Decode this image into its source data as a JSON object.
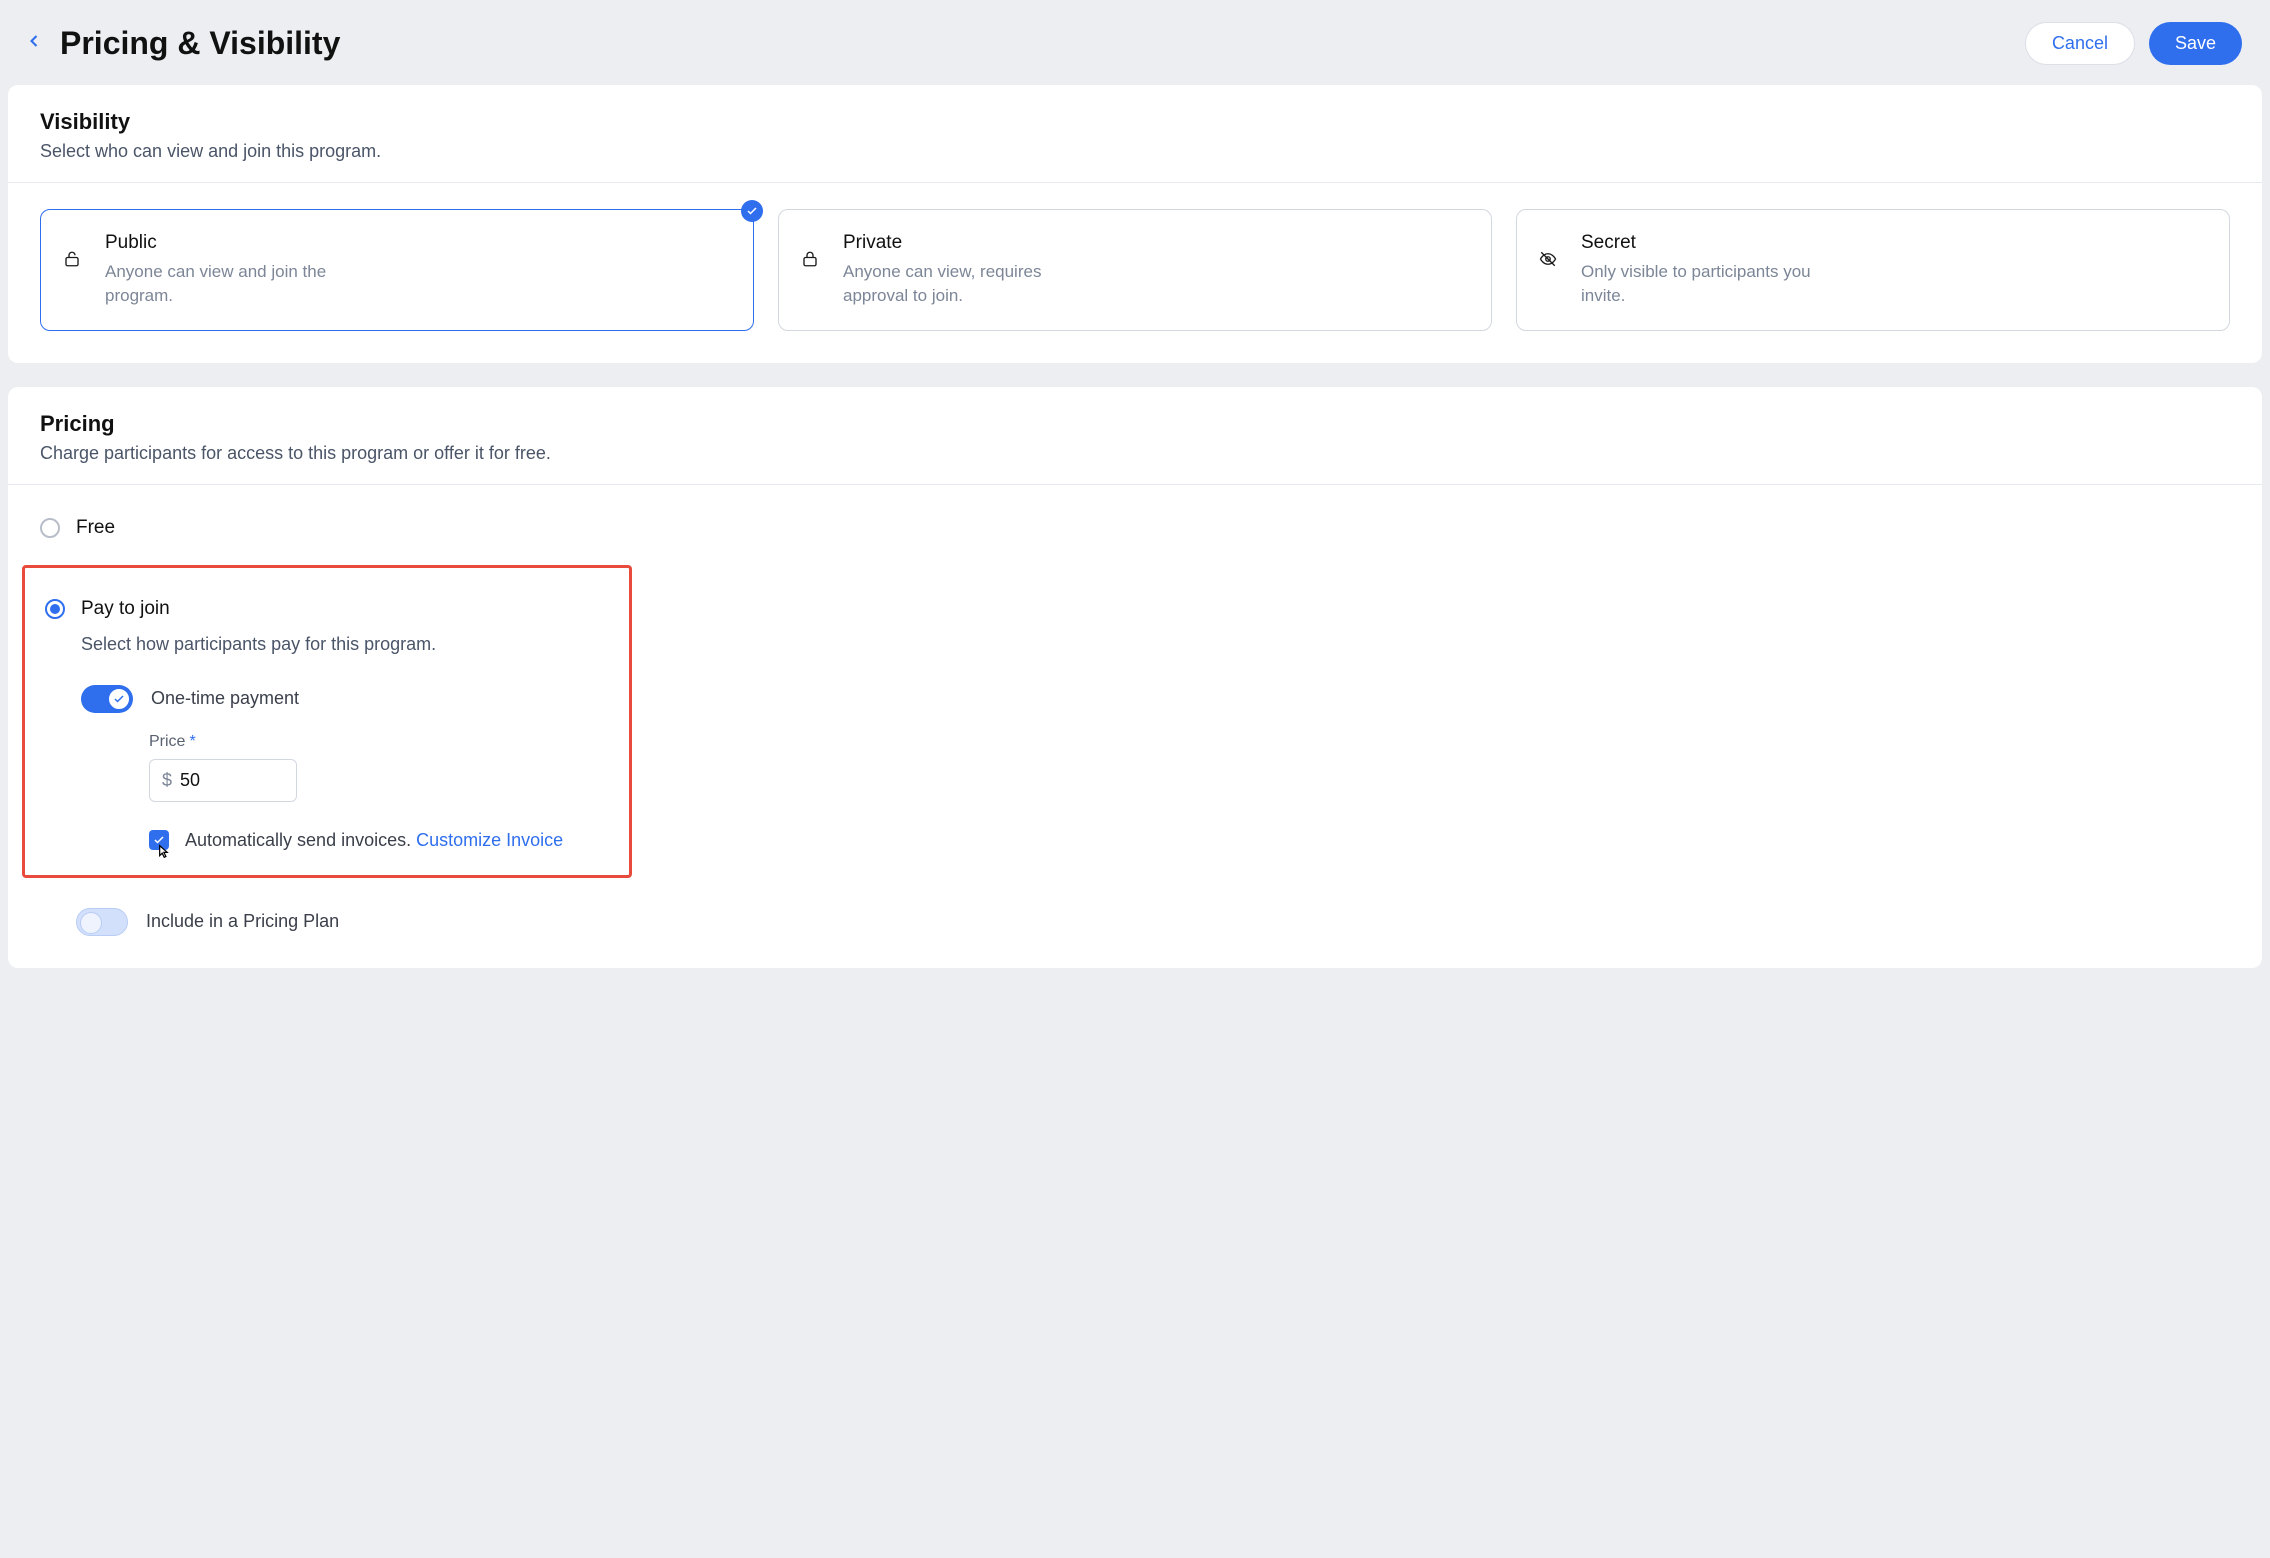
{
  "header": {
    "title": "Pricing & Visibility",
    "cancel": "Cancel",
    "save": "Save"
  },
  "visibility": {
    "title": "Visibility",
    "subtitle": "Select who can view and join this program.",
    "options": [
      {
        "title": "Public",
        "desc": "Anyone can view and join the program.",
        "selected": true
      },
      {
        "title": "Private",
        "desc": "Anyone can view, requires approval to join.",
        "selected": false
      },
      {
        "title": "Secret",
        "desc": "Only visible to participants you invite.",
        "selected": false
      }
    ]
  },
  "pricing": {
    "title": "Pricing",
    "subtitle": "Charge participants for access to this program or offer it for free.",
    "free_label": "Free",
    "pay_label": "Pay to join",
    "pay_desc": "Select how participants pay for this program.",
    "one_time_label": "One-time payment",
    "price_label": "Price",
    "price_currency": "$",
    "price_value": "50",
    "invoice_text": "Automatically send invoices.",
    "customize_link": "Customize Invoice",
    "plan_label": "Include in a Pricing Plan"
  }
}
